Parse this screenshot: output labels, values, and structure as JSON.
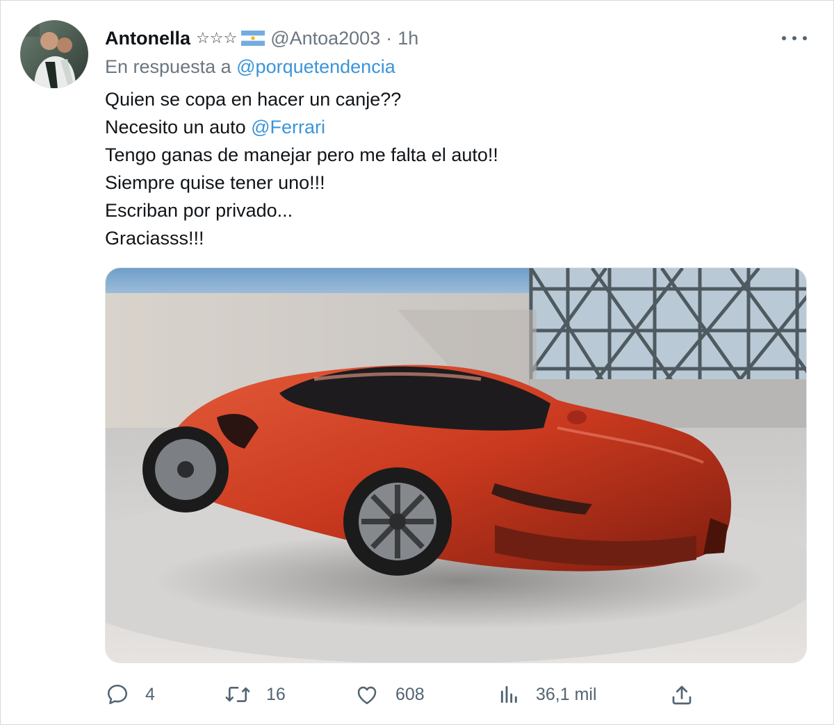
{
  "tweet": {
    "author": {
      "display_name": "Antonella",
      "badges": "☆☆☆",
      "handle": "@Antoa2003",
      "separator": "·",
      "time": "1h"
    },
    "reply": {
      "prefix": "En respuesta a",
      "mention": "@porquetendencia"
    },
    "lines": [
      "Quien se copa en hacer un canje??",
      "Necesito un auto ",
      "Tengo ganas de manejar pero me falta el auto!!",
      "Siempre quise tener uno!!!",
      "Escriban por privado...",
      "Graciasss!!!"
    ],
    "inline_mention": "@Ferrari",
    "actions": {
      "replies": "4",
      "retweets": "16",
      "likes": "608",
      "views": "36,1 mil"
    },
    "icons": {
      "reply": "reply-icon",
      "retweet": "retweet-icon",
      "like": "heart-icon",
      "views": "views-icon",
      "share": "share-icon",
      "more": "more-icon"
    },
    "colors": {
      "link": "#3b94d9",
      "muted": "#6b7680",
      "text": "#0f1419"
    }
  }
}
